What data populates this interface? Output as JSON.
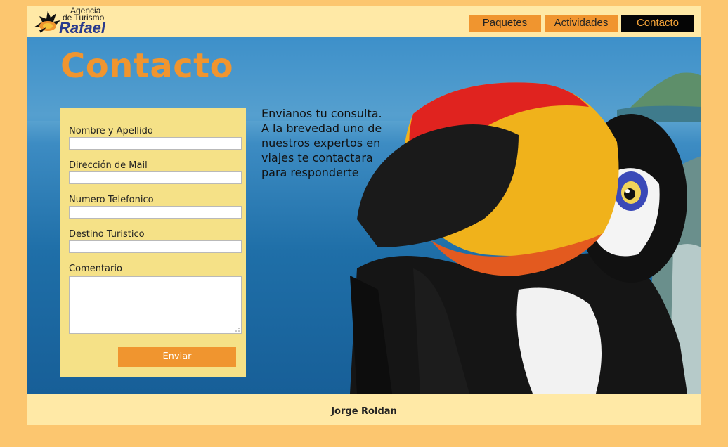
{
  "brand": {
    "line1": "Agencia",
    "line2": "de Turismo",
    "name": "Rafael"
  },
  "nav": {
    "items": [
      {
        "label": "Paquetes"
      },
      {
        "label": "Actividades"
      },
      {
        "label": "Contacto"
      }
    ],
    "active": "Contacto"
  },
  "main": {
    "title": "Contacto",
    "intro_lines": [
      "Envianos tu consulta.",
      "A la brevedad uno de",
      "nuestros expertos en",
      "viajes te contactara",
      "para responderte"
    ]
  },
  "form": {
    "fields": [
      {
        "label": "Nombre y Apellido",
        "value": ""
      },
      {
        "label": "Dirección de Mail",
        "value": ""
      },
      {
        "label": "Numero Telefonico",
        "value": ""
      },
      {
        "label": "Destino Turistico",
        "value": ""
      }
    ],
    "comment_label": "Comentario",
    "comment_value": "",
    "submit_label": "Enviar"
  },
  "footer": {
    "author": "Jorge Roldan"
  },
  "colors": {
    "background": "#fcc66f",
    "panel": "#ffe9a6",
    "accent": "#f0952f",
    "form_bg": "#f5e187",
    "active_nav_bg": "#050505"
  },
  "icons": {
    "logo": "toucan-icon",
    "hero": "toucan-illustration"
  }
}
